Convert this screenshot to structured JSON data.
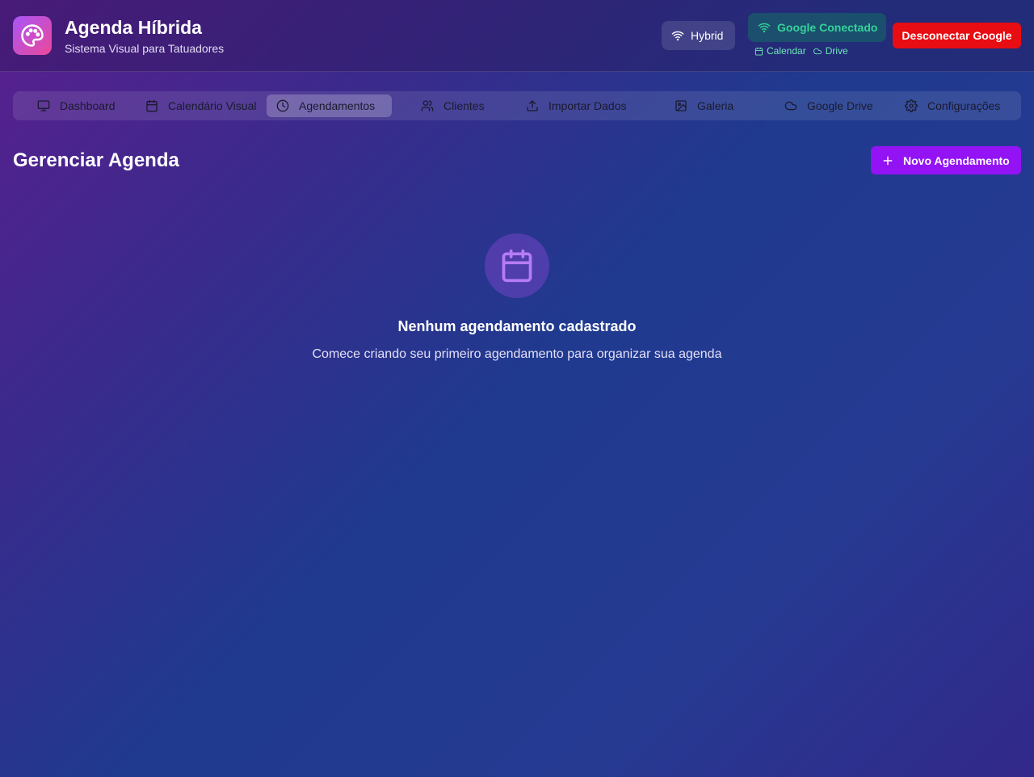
{
  "app": {
    "title": "Agenda Híbrida",
    "subtitle": "Sistema Visual para Tatuadores",
    "logo_icon": "palette-icon"
  },
  "header": {
    "mode_label": "Hybrid",
    "google_status_label": "Google Conectado",
    "google_services": [
      {
        "label": "Calendar",
        "icon": "calendar-icon"
      },
      {
        "label": "Drive",
        "icon": "cloud-icon"
      }
    ],
    "disconnect_label": "Desconectar Google"
  },
  "nav": {
    "active": "Agendamentos",
    "tabs": [
      {
        "label": "Dashboard",
        "icon": "monitor-icon"
      },
      {
        "label": "Calendário Visual",
        "icon": "calendar-icon"
      },
      {
        "label": "Agendamentos",
        "icon": "clock-icon"
      },
      {
        "label": "Clientes",
        "icon": "users-icon"
      },
      {
        "label": "Importar Dados",
        "icon": "upload-icon"
      },
      {
        "label": "Galeria",
        "icon": "image-icon"
      },
      {
        "label": "Google Drive",
        "icon": "cloud-icon"
      },
      {
        "label": "Configurações",
        "icon": "gear-icon"
      }
    ]
  },
  "main": {
    "title": "Gerenciar Agenda",
    "new_button_label": "Novo Agendamento",
    "empty_state": {
      "icon": "calendar-icon",
      "title": "Nenhum agendamento cadastrado",
      "description": "Comece criando seu primeiro agendamento para organizar sua agenda"
    }
  },
  "colors": {
    "accent": "#9313f5",
    "danger": "#e70d12",
    "success": "#34d399"
  }
}
